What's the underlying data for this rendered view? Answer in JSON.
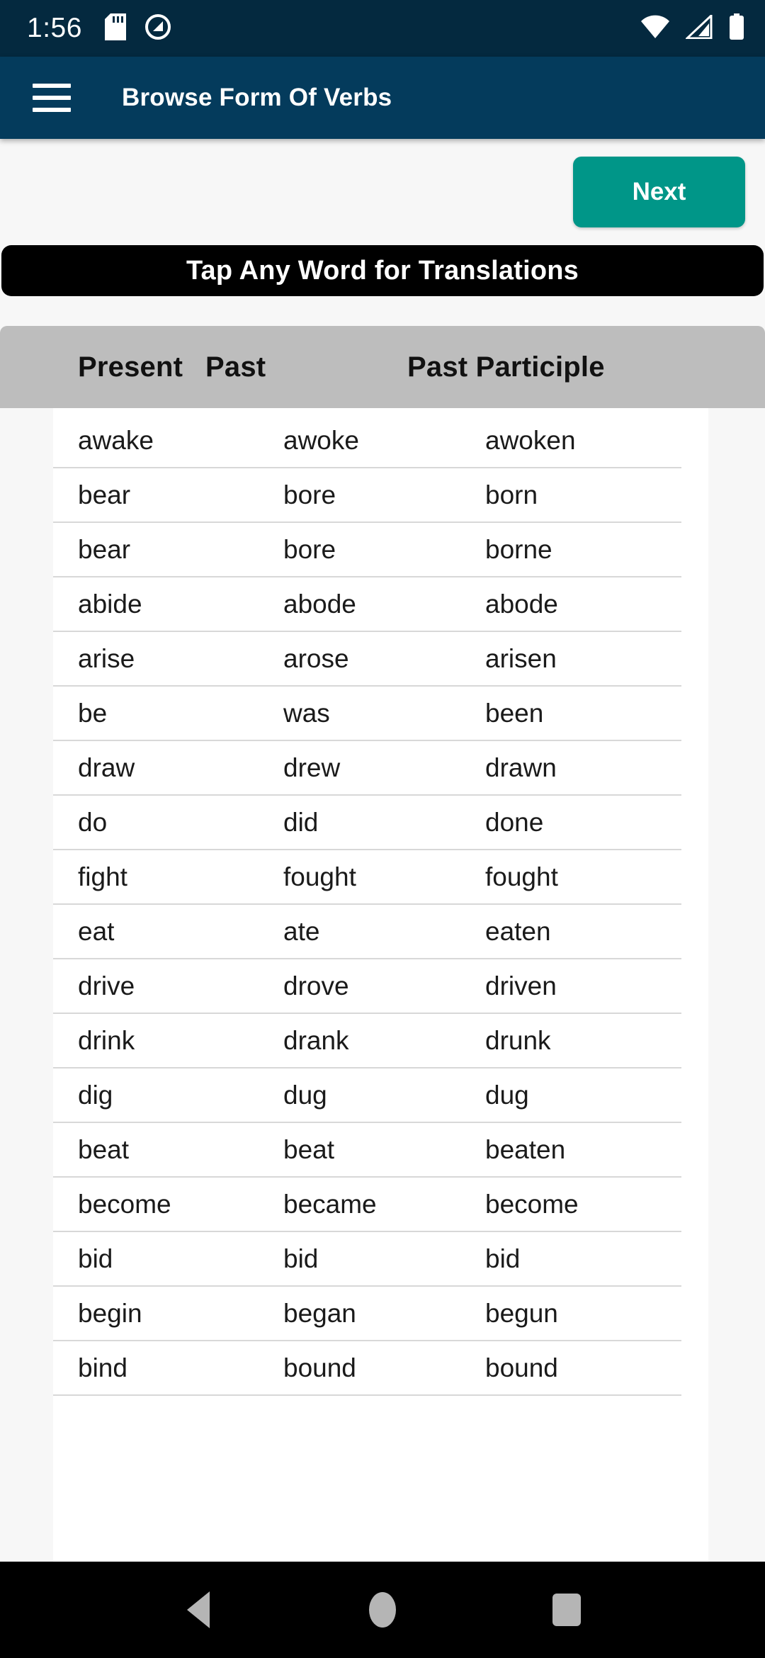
{
  "status_bar": {
    "time": "1:56",
    "icons_left": [
      "sd-card-icon",
      "quality-q-icon"
    ],
    "icons_right": [
      "wifi-icon",
      "signal-icon",
      "battery-icon"
    ],
    "background_color": "#04293f"
  },
  "app_bar": {
    "menu_icon": "hamburger-menu-icon",
    "title": "Browse Form Of Verbs",
    "background_color": "#043b5c"
  },
  "toolbar": {
    "next_label": "Next",
    "next_color": "#009688"
  },
  "banner": {
    "text": "Tap Any Word for Translations",
    "background_color": "#000000"
  },
  "table": {
    "header_background": "#bdbdbd",
    "columns": [
      "Present",
      "Past",
      "Past Participle"
    ],
    "rows": [
      [
        "awake",
        "awoke",
        "awoken"
      ],
      [
        "bear",
        "bore",
        "born"
      ],
      [
        "bear",
        "bore",
        "borne"
      ],
      [
        "abide",
        "abode",
        "abode"
      ],
      [
        "arise",
        "arose",
        "arisen"
      ],
      [
        "be",
        "was",
        "been"
      ],
      [
        "draw",
        "drew",
        "drawn"
      ],
      [
        "do",
        "did",
        "done"
      ],
      [
        "fight",
        "fought",
        "fought"
      ],
      [
        "eat",
        "ate",
        "eaten"
      ],
      [
        "drive",
        "drove",
        "driven"
      ],
      [
        "drink",
        "drank",
        "drunk"
      ],
      [
        "dig",
        "dug",
        "dug"
      ],
      [
        "beat",
        "beat",
        "beaten"
      ],
      [
        "become",
        "became",
        "become"
      ],
      [
        "bid",
        "bid",
        "bid"
      ],
      [
        "begin",
        "began",
        "begun"
      ],
      [
        "bind",
        "bound",
        "bound"
      ]
    ]
  },
  "nav_bar": {
    "back": "back-triangle-icon",
    "home": "home-circle-icon",
    "recents": "recents-square-icon",
    "background_color": "#000000"
  }
}
